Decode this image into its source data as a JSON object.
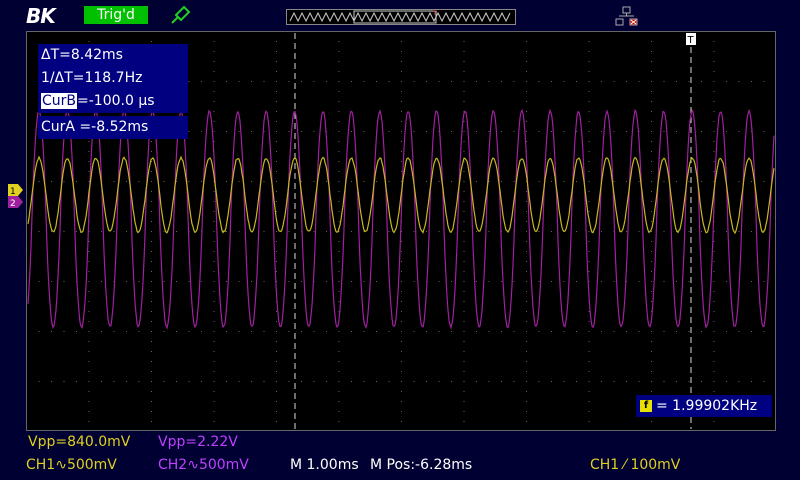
{
  "header": {
    "logo": "BK",
    "trigger_status": "Trig'd",
    "trigger_marker": "T",
    "icons": [
      "probe-icon",
      "network-icon"
    ]
  },
  "cursors": {
    "delta_t": "ΔT=8.42ms",
    "inverse_delta_t": "1/ΔT=118.7Hz",
    "cur_b_label": "CurB",
    "cur_b_value": "=-100.0 μs",
    "cur_a": "CurA =-8.52ms"
  },
  "frequency": {
    "icon_text": "f",
    "value": "= 1.99902KHz"
  },
  "channels": {
    "ch1_vpp": "Vpp=840.0mV",
    "ch2_vpp": "Vpp=2.22V",
    "ch1_scale": "CH1∿500mV",
    "ch2_scale": "CH2∿500mV",
    "ch1_marker": "1",
    "ch2_marker": "2"
  },
  "timebase": {
    "main": "M 1.00ms",
    "position": "M Pos:-6.28ms"
  },
  "trigger": {
    "setting": "CH1 ⁄ 100mV"
  },
  "colors": {
    "background": "#000033",
    "ch1": "#e0d020",
    "ch2": "#a020a0",
    "grid": "#5a5a5a",
    "trig_green": "#00c000",
    "cursor_box": "#000080"
  }
}
